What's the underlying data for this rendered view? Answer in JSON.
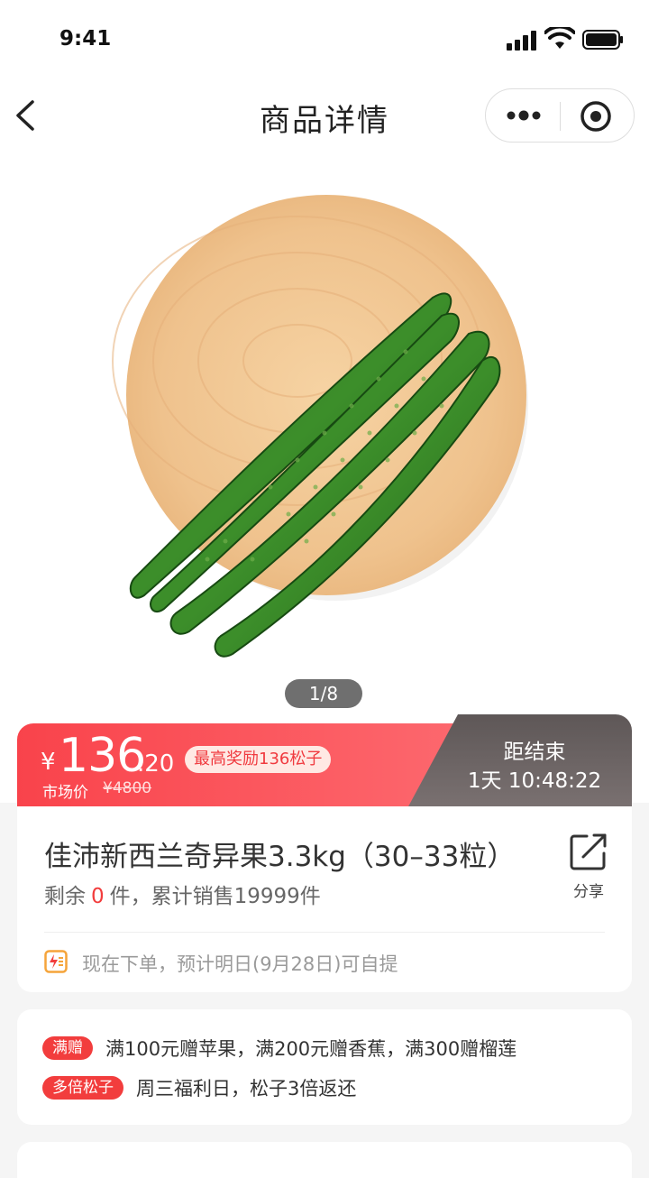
{
  "status_bar": {
    "time": "9:41"
  },
  "nav": {
    "title": "商品详情"
  },
  "gallery": {
    "indicator": "1/8"
  },
  "price": {
    "currency": "¥",
    "integer": "136",
    "decimal": ".20",
    "reward_tag": "最高奖励136松子",
    "market_label": "市场价",
    "market_price": "¥4800"
  },
  "countdown": {
    "label": "距结束",
    "time": "1天 10:48:22"
  },
  "product": {
    "title": "佳沛新西兰奇异果3.3kg（30–33粒）",
    "stock_prefix": "剩余",
    "stock_count": "0",
    "stock_suffix": "件，累计销售19999件",
    "share_label": "分享",
    "delivery_text": "现在下单，预计明日(9月28日)可自提"
  },
  "promotions": [
    {
      "tag": "满赠",
      "text": "满100元赠苹果，满200元赠香蕉，满300赠榴莲"
    },
    {
      "tag": "多倍松子",
      "text": "周三福利日，松子3倍返还"
    }
  ],
  "colors": {
    "accent_red": "#f9434b",
    "countdown_bg": "#5e5757",
    "tag_red": "#f23d3d"
  },
  "icons": [
    "back-icon",
    "more-icon",
    "close-mini-icon",
    "share-icon",
    "delivery-icon"
  ]
}
